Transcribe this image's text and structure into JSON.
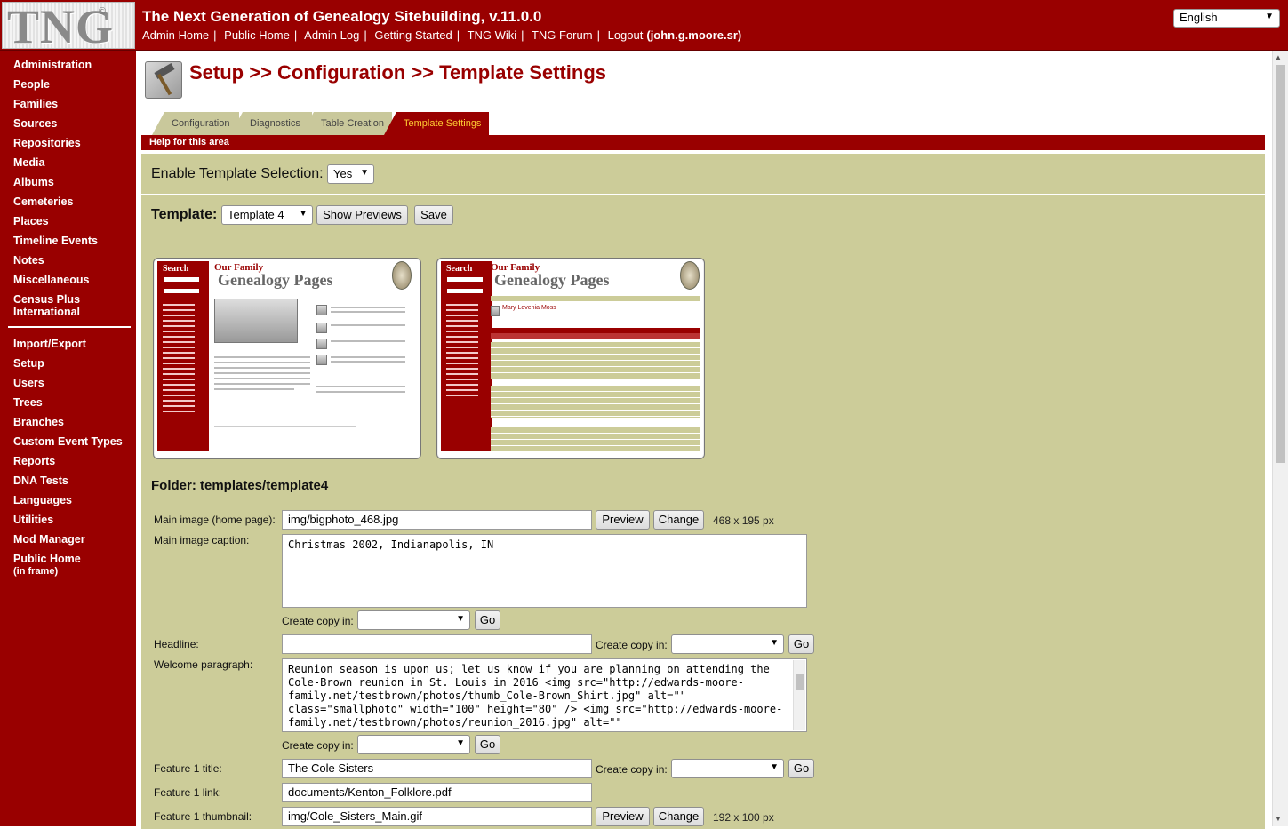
{
  "header": {
    "logo_text": "TNG",
    "logo_mark": "©",
    "title": "The Next Generation of Genealogy Sitebuilding, v.11.0.0",
    "links": [
      "Admin Home",
      "Public Home",
      "Admin Log",
      "Getting Started",
      "TNG Wiki",
      "TNG Forum",
      "Logout"
    ],
    "user": "(john.g.moore.sr)",
    "language": "English"
  },
  "sidebar": {
    "items": [
      "Administration",
      "People",
      "Families",
      "Sources",
      "Repositories",
      "Media",
      "Albums",
      "Cemeteries",
      "Places",
      "Timeline Events",
      "Notes",
      "Miscellaneous",
      "Census Plus",
      "International",
      "Import/Export",
      "Setup",
      "Users",
      "Trees",
      "Branches",
      "Custom Event Types",
      "Reports",
      "DNA Tests",
      "Languages",
      "Utilities",
      "Mod Manager",
      "Public Home",
      "(in frame)"
    ]
  },
  "page": {
    "title": "Setup >> Configuration >> Template Settings",
    "tabs": [
      "Configuration",
      "Diagnostics",
      "Table Creation",
      "Template Settings"
    ],
    "help": "Help for this area"
  },
  "form": {
    "enable_label": "Enable Template Selection:",
    "enable_value": "Yes",
    "template_label": "Template:",
    "template_value": "Template 4",
    "show_previews": "Show Previews",
    "save": "Save",
    "folder": "Folder: templates/template4",
    "preview_btn": "Preview",
    "change_btn": "Change",
    "go_btn": "Go",
    "create_copy": "Create copy in:",
    "main_image_label": "Main image (home page):",
    "main_image_value": "img/bigphoto_468.jpg",
    "main_image_dims": "468 x 195 px",
    "caption_label": "Main image caption:",
    "caption_value": "Christmas 2002, Indianapolis, IN",
    "headline_label": "Headline:",
    "headline_value": "",
    "welcome_label": "Welcome paragraph:",
    "welcome_value": "Reunion season is upon us; let us know if you are planning on attending the Cole-Brown reunion in St. Louis in 2016 <img src=\"http://edwards-moore-family.net/testbrown/photos/thumb_Cole-Brown_Shirt.jpg\" alt=\"\" class=\"smallphoto\" width=\"100\" height=\"80\" /> <img src=\"http://edwards-moore-family.net/testbrown/photos/reunion_2016.jpg\" alt=\"\"",
    "f1_title_label": "Feature 1 title:",
    "f1_title_value": "The Cole Sisters",
    "f1_link_label": "Feature 1 link:",
    "f1_link_value": "documents/Kenton_Folklore.pdf",
    "f1_thumb_label": "Feature 1 thumbnail:",
    "f1_thumb_value": "img/Cole_Sisters_Main.gif",
    "f1_thumb_dims": "192 x 100 px"
  },
  "previews": {
    "search": "Search",
    "our_family": "Our Family",
    "genealogy_pages": "Genealogy Pages",
    "person_name": "Mary Lovenia Moss"
  },
  "colors": {
    "brand": "#990000",
    "panel": "#cccc99",
    "tab_active_text": "#ffcc33"
  }
}
